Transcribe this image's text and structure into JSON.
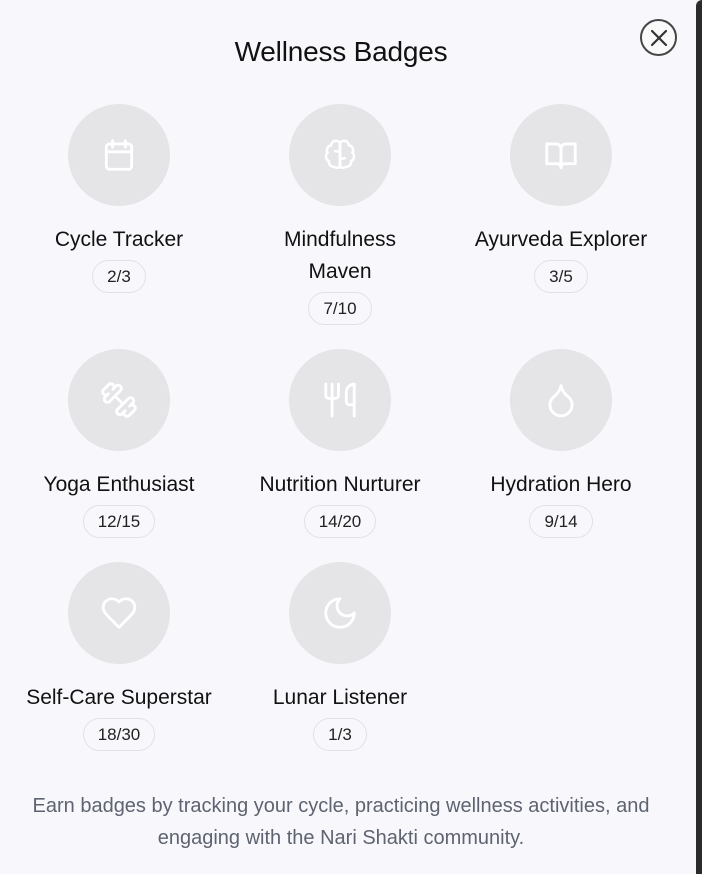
{
  "modal": {
    "title": "Wellness Badges",
    "close_label": "close",
    "footer": "Earn badges by tracking your cycle, practicing wellness activities, and engaging with the Nari Shakti community."
  },
  "badges": [
    {
      "name": "Cycle Tracker",
      "count": "2/3",
      "icon": "calendar-icon"
    },
    {
      "name": "Mindfulness Maven",
      "count": "7/10",
      "icon": "brain-icon"
    },
    {
      "name": "Ayurveda Explorer",
      "count": "3/5",
      "icon": "book-icon"
    },
    {
      "name": "Yoga Enthusiast",
      "count": "12/15",
      "icon": "dumbbell-icon"
    },
    {
      "name": "Nutrition Nurturer",
      "count": "14/20",
      "icon": "utensils-icon"
    },
    {
      "name": "Hydration Hero",
      "count": "9/14",
      "icon": "droplet-icon"
    },
    {
      "name": "Self-Care Superstar",
      "count": "18/30",
      "icon": "heart-icon"
    },
    {
      "name": "Lunar Listener",
      "count": "1/3",
      "icon": "moon-icon"
    }
  ],
  "colors": {
    "background": "#f8f8fc",
    "icon_circle": "#e5e5e8",
    "icon_stroke": "#ffffff",
    "footer_text": "#5d6370"
  }
}
